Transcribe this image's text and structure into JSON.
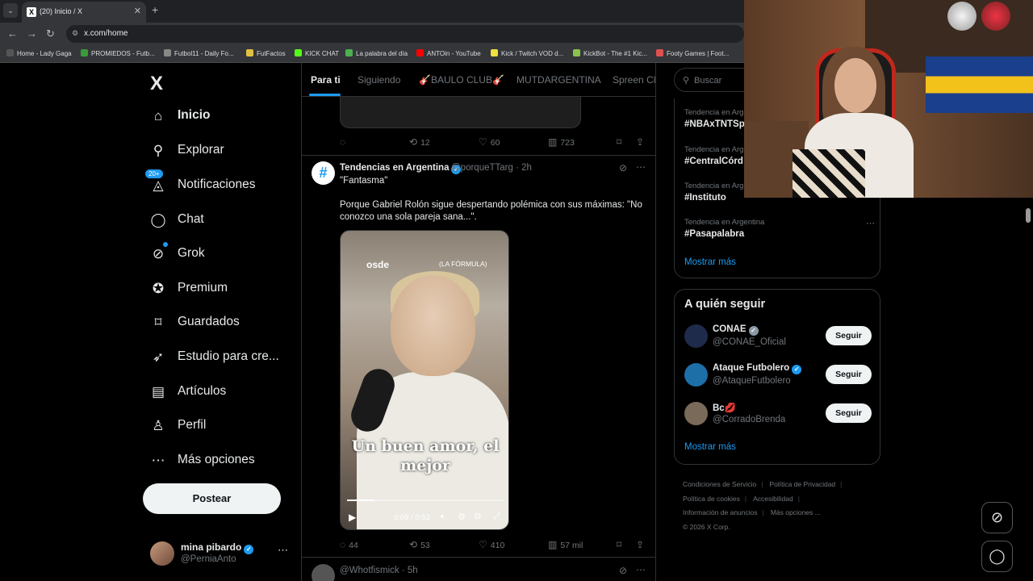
{
  "browser": {
    "tab_title": "(20) Inicio / X",
    "url": "x.com/home",
    "bookmarks": [
      {
        "label": "Home - Lady Gaga",
        "color": "#555555"
      },
      {
        "label": "PROMIEDOS - Futb...",
        "color": "#3a9b3a"
      },
      {
        "label": "Futbol11 - Daily Fo...",
        "color": "#888888"
      },
      {
        "label": "FutFactos",
        "color": "#e0c040"
      },
      {
        "label": "KICK CHAT",
        "color": "#53fc18"
      },
      {
        "label": "La palabra del día",
        "color": "#4caf50"
      },
      {
        "label": "ANTOin - YouTube",
        "color": "#ff0000"
      },
      {
        "label": "Kick / Twitch VOD d...",
        "color": "#f0e040"
      },
      {
        "label": "KickBot - The #1 Kic...",
        "color": "#8bc34a"
      },
      {
        "label": "Footy Games | Foot...",
        "color": "#e05050"
      }
    ]
  },
  "sidebar": {
    "logo": "X",
    "items": [
      {
        "label": "Inicio",
        "icon": "home-icon",
        "glyph": "⌂"
      },
      {
        "label": "Explorar",
        "icon": "search-icon",
        "glyph": "⚲"
      },
      {
        "label": "Notificaciones",
        "icon": "bell-icon",
        "glyph": "🔔︎"
      },
      {
        "label": "Chat",
        "icon": "chat-icon",
        "glyph": "◯"
      },
      {
        "label": "Grok",
        "icon": "grok-icon",
        "glyph": "⊘"
      },
      {
        "label": "Premium",
        "icon": "premium-icon",
        "glyph": "✪"
      },
      {
        "label": "Guardados",
        "icon": "bookmark-icon",
        "glyph": "⌑"
      },
      {
        "label": "Estudio para cre...",
        "icon": "rocket-icon",
        "glyph": "➶"
      },
      {
        "label": "Artículos",
        "icon": "article-icon",
        "glyph": "▤"
      },
      {
        "label": "Perfil",
        "icon": "profile-icon",
        "glyph": "♙"
      },
      {
        "label": "Más opciones",
        "icon": "more-icon",
        "glyph": "⋯"
      }
    ],
    "notif_badge": "20+",
    "post_button": "Postear",
    "account": {
      "name": "mina pibardo",
      "handle": "@PerniaAnto"
    }
  },
  "feed": {
    "tabs": [
      "Para ti",
      "Siguiendo",
      "🎸BAULO CLUB🎸",
      "MUTDARGENTINA",
      "Spreen Cla"
    ],
    "prev_post_actions": {
      "replies": "",
      "reposts": "12",
      "likes": "60",
      "views": "723"
    },
    "post": {
      "author": "Tendencias en Argentina",
      "handle": "@porqueTTarg",
      "time": "· 2h",
      "title": "\"Fantasma\"",
      "text": "Porque Gabriel Rolón sigue despertando polémica con sus máximas: \"No conozco una sola pareja sana...\".",
      "video": {
        "brand": "osde",
        "show": "(LA FÓRMULA)",
        "caption": "Un buen amor, el mejor",
        "time": "0:09 / 0:53",
        "progress": 0.17
      },
      "actions": {
        "replies": "44",
        "reposts": "53",
        "likes": "410",
        "views": "57 mil"
      }
    },
    "next_post": {
      "handle": "@Whotfismick",
      "time": "· 5h"
    }
  },
  "right": {
    "search_placeholder": "Buscar",
    "trends": [
      {
        "category": "Tendencia en Arg",
        "tag": "#NBAxTNTSp"
      },
      {
        "category": "Tendencia en Arg",
        "tag": "#CentralCórd"
      },
      {
        "category": "Tendencia en Arg",
        "tag": "#Instituto"
      },
      {
        "category": "Tendencia en Argentina",
        "tag": "#Pasapalabra"
      }
    ],
    "show_more": "Mostrar más",
    "who_to_follow": {
      "title": "A quién seguir",
      "users": [
        {
          "name": "CONAE",
          "handle": "@CONAE_Oficial",
          "button": "Seguir",
          "color": "#1e2b4a"
        },
        {
          "name": "Ataque Futbolero",
          "handle": "@AtaqueFutbolero",
          "button": "Seguir",
          "color": "#1d6fa8"
        },
        {
          "name": "Bc💋",
          "handle": "@CorradoBrenda",
          "button": "Seguir",
          "color": "#7a6a5a"
        }
      ],
      "show_more": "Mostrar más"
    },
    "footer": {
      "links": [
        "Condiciones de Servicio",
        "Política de Privacidad",
        "Política de cookies",
        "Accesibilidad",
        "Información de anuncios",
        "Más opciones ..."
      ],
      "copyright": "© 2026 X Corp."
    }
  }
}
